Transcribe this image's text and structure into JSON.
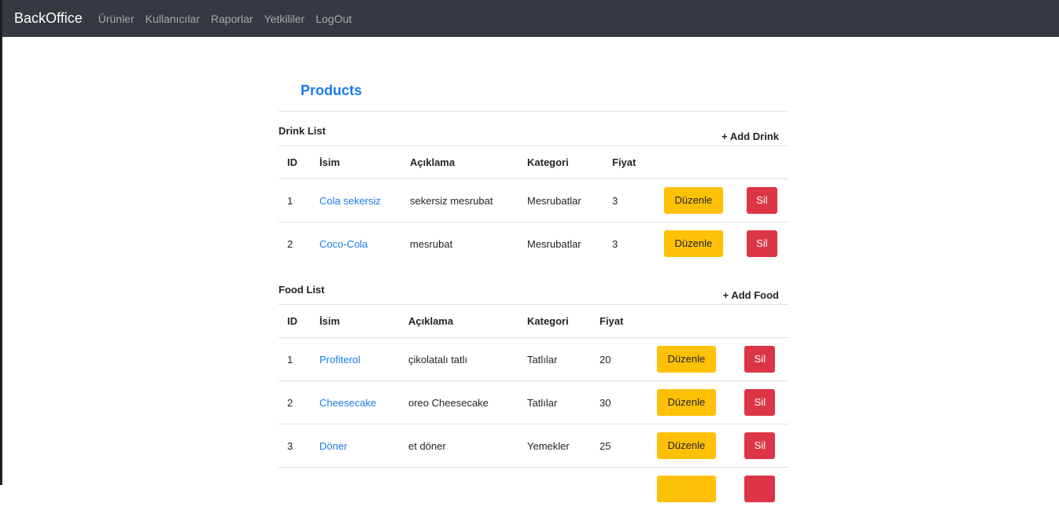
{
  "navbar": {
    "brand": "BackOffice",
    "links": [
      "Ürünler",
      "Kullanıcılar",
      "Raporlar",
      "Yetkililer",
      "LogOut"
    ]
  },
  "page": {
    "title": "Products"
  },
  "drinks": {
    "title": "Drink List",
    "add_label": "+ Add Drink",
    "headers": [
      "ID",
      "İsim",
      "Açıklama",
      "Kategori",
      "Fiyat"
    ],
    "rows": [
      {
        "id": "1",
        "name": "Cola sekersiz",
        "description": "sekersiz mesrubat",
        "category": "Mesrubatlar",
        "price": "3"
      },
      {
        "id": "2",
        "name": "Coco-Cola",
        "description": "mesrubat",
        "category": "Mesrubatlar",
        "price": "3"
      }
    ]
  },
  "foods": {
    "title": "Food List",
    "add_label": "+ Add Food",
    "headers": [
      "ID",
      "İsim",
      "Açıklama",
      "Kategori",
      "Fiyat"
    ],
    "rows": [
      {
        "id": "1",
        "name": "Profiterol",
        "description": "çikolatalı tatlı",
        "category": "Tatlılar",
        "price": "20"
      },
      {
        "id": "2",
        "name": "Cheesecake",
        "description": "oreo Cheesecake",
        "category": "Tatlılar",
        "price": "30"
      },
      {
        "id": "3",
        "name": "Döner",
        "description": "et döner",
        "category": "Yemekler",
        "price": "25"
      }
    ]
  },
  "actions": {
    "edit_label": "Düzenle",
    "delete_label": "Sil"
  },
  "colors": {
    "navbar_bg": "#343a40",
    "link": "#1a7bea",
    "edit_button": "#ffc107",
    "delete_button": "#dc3545"
  }
}
